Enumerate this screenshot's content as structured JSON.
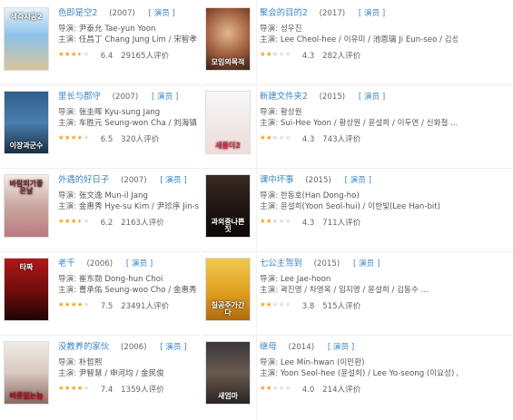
{
  "labels": {
    "director": "导演:",
    "cast": "主演:",
    "tag": "[ 演员 ]"
  },
  "movies": [
    {
      "title": "色即是空2",
      "year": "(2007)",
      "director": "尹泰允 Tae-yun Yoon",
      "cast": "任昌丁 Chang Jung Lim / 宋智孝",
      "rating": 6.4,
      "score": "6.4",
      "count": "29165人评价",
      "poster": {
        "bg": "linear-gradient(180deg,#e7f1fb 0%,#8cc3ea 45%,#d9c49a 100%)",
        "text": "색즉시공2",
        "text_pos": "top"
      }
    },
    {
      "title": "聚会的目的2",
      "year": "(2017)",
      "director": "성우진",
      "cast": "Lee Cheol-hee / 이유미 / 池恩璃 Ji Eun-seo / 김성환 / 郑馨敏...",
      "rating": 4.3,
      "score": "4.3",
      "count": "282人评价",
      "poster": {
        "bg": "radial-gradient(circle at 50% 40%,#e4b590 0%,#9b5a3a 55%,#3a1e14 100%)",
        "text": "모임의목적",
        "text_pos": "bottom"
      }
    },
    {
      "title": "里长与郡守",
      "year": "(2007)",
      "director": "张圭晖 Kyu-sung Jang",
      "cast": "车胜元 Seung-won Cha / 刘海镇",
      "rating": 6.5,
      "score": "6.5",
      "count": "320人评价",
      "poster": {
        "bg": "linear-gradient(180deg,#2f5f8a 0%,#497fae 50%,#1c2f44 100%)",
        "text": "이장과군수",
        "text_pos": "bottom"
      }
    },
    {
      "title": "新建文件夹2",
      "year": "(2015)",
      "director": "황상원",
      "cast": "Sui-Hee Yoon / 황상원 / 윤설희 / 이두연 / 신화철 ...",
      "rating": 4.3,
      "score": "4.3",
      "count": "743人评价",
      "poster": {
        "bg": "linear-gradient(180deg,#f7f7f7 0%,#f0e6e6 60%,#f4dada 100%)",
        "text": "새폴더2",
        "text_pos": "bottom",
        "text_color": "#e03048"
      }
    },
    {
      "title": "外遇的好日子",
      "year": "(2007)",
      "director": "张文逸 Mun-il Jang",
      "cast": "金惠秀 Hye-su Kim / 尹珍序 Jin-s",
      "rating": 6.2,
      "score": "6.2",
      "count": "2163人评价",
      "poster": {
        "bg": "linear-gradient(180deg,#f4ece4 0%,#caa7a0 50%,#ba7a7f 100%)",
        "text": "바람피기좋은날",
        "text_pos": "top",
        "text_color": "#7a2a3a"
      }
    },
    {
      "title": "课中坏事",
      "year": "(2015)",
      "director": "한동호(Han Dong-ho)",
      "cast": "윤설희(Yoon Seol-hui) / 이한빛(Lee Han-bit)",
      "rating": 4.3,
      "score": "4.3",
      "count": "711人评价",
      "poster": {
        "bg": "linear-gradient(180deg,#3a2a22 0%,#1c1410 60%,#0c0807 100%)",
        "text": "과외중나쁜짓",
        "text_pos": "bottom"
      }
    },
    {
      "title": "老千",
      "year": "(2006)",
      "director": "崔东勋 Dong-hun Choi",
      "cast": "曹承佑 Seung-woo Cho / 金惠秀",
      "rating": 7.5,
      "score": "7.5",
      "count": "23491人评价",
      "poster": {
        "bg": "linear-gradient(180deg,#b01818 0%,#6e0c0c 55%,#1e0505 100%)",
        "text": "타짜",
        "text_pos": "top"
      }
    },
    {
      "title": "七公主驾到",
      "year": "(2015)",
      "director": "Lee Jae-hoon",
      "cast": "곽진영 / 차영옥 / 임지영 / 윤설희 / 김동수 ...",
      "rating": 3.8,
      "score": "3.8",
      "count": "515人评价",
      "poster": {
        "bg": "linear-gradient(180deg,#f0c850 0%,#e0a020 55%,#b06a10 100%)",
        "text": "칠공주가간다",
        "text_pos": "bottom",
        "text_color": "#fff"
      }
    },
    {
      "title": "没教养的家伙",
      "year": "(2006)",
      "director": "朴哲熙",
      "cast": "尹智慧 / 申河均 / 金民俊",
      "rating": 7.4,
      "score": "7.4",
      "count": "1359人评价",
      "poster": {
        "bg": "linear-gradient(180deg,#f0ece8 0%,#d8c8c0 50%,#8a6a60 100%)",
        "text": "버릇없는놈",
        "text_pos": "bottom",
        "text_color": "#c01020"
      }
    },
    {
      "title": "继母",
      "year": "(2014)",
      "director": "Lee Min-hwan (이민환)",
      "cast": "Yoon Seol-hee (윤설희) / Lee Yo-seong (이요성) / Kim Min-seo...",
      "rating": 4.0,
      "score": "4.0",
      "count": "214人评价",
      "poster": {
        "bg": "linear-gradient(180deg,#3a3a3a 0%,#6a5a50 50%,#2a2420 100%)",
        "text": "새엄마",
        "text_pos": "bottom"
      }
    }
  ]
}
